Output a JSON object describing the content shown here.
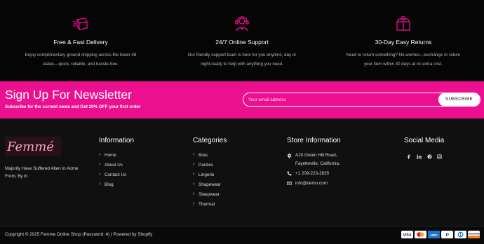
{
  "features": [
    {
      "icon": "delivery-box-icon",
      "title": "Free & Fast Delivery",
      "desc_line1": "Enjoy complimentary ground shipping across the lower 48",
      "desc_line2": "states—quick, reliable, and hassle-free."
    },
    {
      "icon": "support-agent-icon",
      "title": "24/7 Online Support",
      "desc_line1": "Our friendly support team is here for you anytime, day or",
      "desc_line2": "night,ready to help with anything you need."
    },
    {
      "icon": "gift-box-icon",
      "title": "30-Day Easy Returns",
      "desc_line1": "Need to return something? No worries—exchange or return",
      "desc_line2": "your item within 30 days at no extra cost."
    }
  ],
  "newsletter": {
    "title": "Sign Up For Newsletter",
    "subtitle": "Subscribe for the current news and Get 20% OFF your first order",
    "placeholder": "Your email address",
    "button": "SUBSCRIBE"
  },
  "brand": {
    "logo_text": "Femmé",
    "about_line1": "Majority Have Suffered Alten In Aome",
    "about_line2": "From, By In"
  },
  "information": {
    "title": "Information",
    "links": [
      "Home",
      "About Us",
      "Contact Us",
      "Blog"
    ]
  },
  "categories": {
    "title": "Categories",
    "links": [
      "Bras",
      "Panties",
      "Lingerie",
      "Shapewear",
      "Sleepwear",
      "Thermal"
    ]
  },
  "store": {
    "title": "Store Information",
    "address_line1": "A20 Green Hill Road,",
    "address_line2": "Fayetteville, California.",
    "phone": "+1 209-223-2635",
    "email": "info@demo.com"
  },
  "social": {
    "title": "Social Media",
    "icons": [
      "facebook-icon",
      "linkedin-icon",
      "pinterest-icon",
      "instagram-icon"
    ]
  },
  "bottom": {
    "copyright": "Copyright © 2025 Femme Online Shop (Password: 4) | Powered by Shopify",
    "payments": [
      "Visa",
      "Mastercard",
      "American Express",
      "PayPal",
      "Diners Club",
      "Discover"
    ]
  },
  "colors": {
    "accent": "#ec1090",
    "background": "#101010"
  }
}
